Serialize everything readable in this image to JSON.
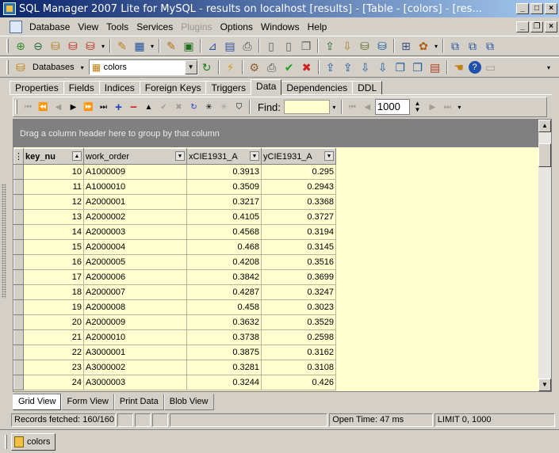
{
  "window": {
    "title": "SQL Manager 2007 Lite for MySQL - results on localhost [results] - [Table - [colors] - [res..."
  },
  "menu": {
    "items": [
      "Database",
      "View",
      "Tools",
      "Services",
      "Plugins",
      "Options",
      "Windows",
      "Help"
    ],
    "disabled": [
      "Plugins"
    ]
  },
  "toolbar2": {
    "databases_label": "Databases",
    "table_combo_value": "colors"
  },
  "tabs": [
    "Properties",
    "Fields",
    "Indices",
    "Foreign Keys",
    "Triggers",
    "Data",
    "Dependencies",
    "DDL"
  ],
  "active_tab": "Data",
  "navigator": {
    "find_label": "Find:",
    "find_value": "",
    "page_size": "1000"
  },
  "grid": {
    "group_hint": "Drag a column header here to group by that column",
    "columns": [
      "key_nu",
      "work_order",
      "xCIE1931_A",
      "yCIE1931_A"
    ],
    "rows": [
      [
        "10",
        "A1000009",
        "0.3913",
        "0.295"
      ],
      [
        "11",
        "A1000010",
        "0.3509",
        "0.2943"
      ],
      [
        "12",
        "A2000001",
        "0.3217",
        "0.3368"
      ],
      [
        "13",
        "A2000002",
        "0.4105",
        "0.3727"
      ],
      [
        "14",
        "A2000003",
        "0.4568",
        "0.3194"
      ],
      [
        "15",
        "A2000004",
        "0.468",
        "0.3145"
      ],
      [
        "16",
        "A2000005",
        "0.4208",
        "0.3516"
      ],
      [
        "17",
        "A2000006",
        "0.3842",
        "0.3699"
      ],
      [
        "18",
        "A2000007",
        "0.4287",
        "0.3247"
      ],
      [
        "19",
        "A2000008",
        "0.458",
        "0.3023"
      ],
      [
        "20",
        "A2000009",
        "0.3632",
        "0.3529"
      ],
      [
        "21",
        "A2000010",
        "0.3738",
        "0.2598"
      ],
      [
        "22",
        "A3000001",
        "0.3875",
        "0.3162"
      ],
      [
        "23",
        "A3000002",
        "0.3281",
        "0.3108"
      ],
      [
        "24",
        "A3000003",
        "0.3244",
        "0.426"
      ]
    ]
  },
  "view_tabs": [
    "Grid View",
    "Form View",
    "Print Data",
    "Blob View"
  ],
  "active_view": "Grid View",
  "status": {
    "records": "Records fetched: 160/160",
    "open_time": "Open Time: 47 ms",
    "limit": "LIMIT 0, 1000"
  },
  "taskbar": {
    "window_label": "colors"
  }
}
